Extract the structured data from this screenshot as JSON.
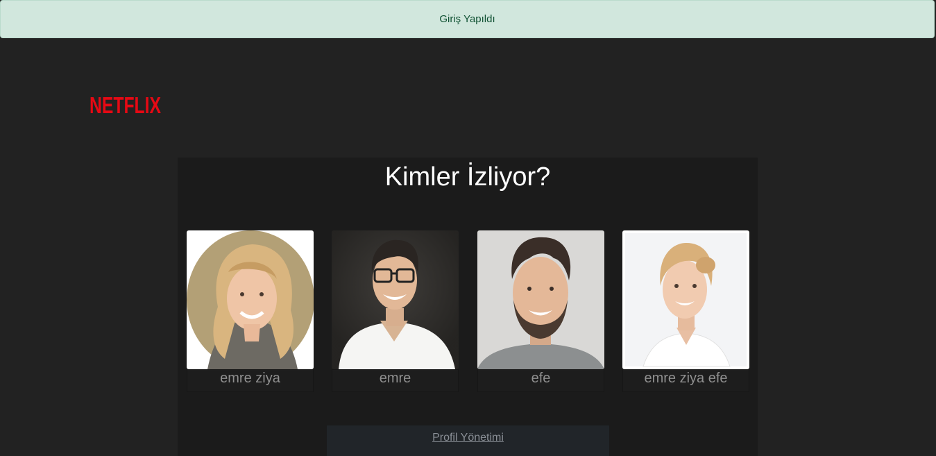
{
  "alert": {
    "message": "Giriş Yapıldı"
  },
  "brand": {
    "logo_text": "NETFLIX",
    "color": "#e50914"
  },
  "heading": "Kimler İzliyor?",
  "profiles": [
    {
      "name": "emre ziya",
      "avatar": "woman-blonde-portrait"
    },
    {
      "name": "emre",
      "avatar": "man-glasses-portrait"
    },
    {
      "name": "efe",
      "avatar": "man-beard-portrait"
    },
    {
      "name": "emre ziya efe",
      "avatar": "woman-white-shirt-portrait"
    }
  ],
  "manage_link": "Profil Yönetimi"
}
